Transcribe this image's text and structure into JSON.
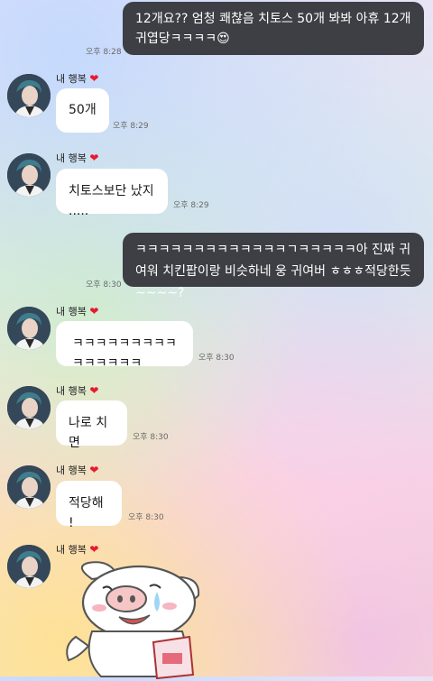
{
  "sender_name": "내 행복",
  "messages": [
    {
      "dir": "out",
      "text": "12개요?? 엄청 쾌찮음 치토스 50개 봐봐 아휴 12개 귀엽당ㅋㅋㅋㅋ😍",
      "time": "오후 8:28"
    },
    {
      "dir": "in",
      "text": "50개",
      "time": "오후 8:29"
    },
    {
      "dir": "in",
      "text": "치토스보단 났지 .....",
      "time": "오후 8:29"
    },
    {
      "dir": "out",
      "text": "ㅋㅋㅋㅋㅋㅋㅋㅋㅋㅋㅋㅋㅋㄱㅋㅋㅋㅋㅋ아 진짜 귀여워 치킨팝이랑 비슷하네 웅 귀여버 ㅎㅎㅎ적당한듯~~~~?",
      "time": "오후 8:30"
    },
    {
      "dir": "in",
      "text": "ㅋㅋㅋㅋㅋㅋㅋㅋㅋㅋㅋㅋㅋㅋㅋ",
      "time": "오후 8:30"
    },
    {
      "dir": "in",
      "text": "나로 치면",
      "time": "오후 8:30"
    },
    {
      "dir": "in",
      "text": "적당해 !",
      "time": "오후 8:30"
    }
  ],
  "icons": {
    "heart": "heart-icon",
    "avatar": "profile-avatar",
    "sticker": "crying-pig-sticker"
  },
  "colors": {
    "outgoing_bubble": "#3d3f45",
    "incoming_bubble": "#ffffff",
    "heart": "#e8192c"
  }
}
